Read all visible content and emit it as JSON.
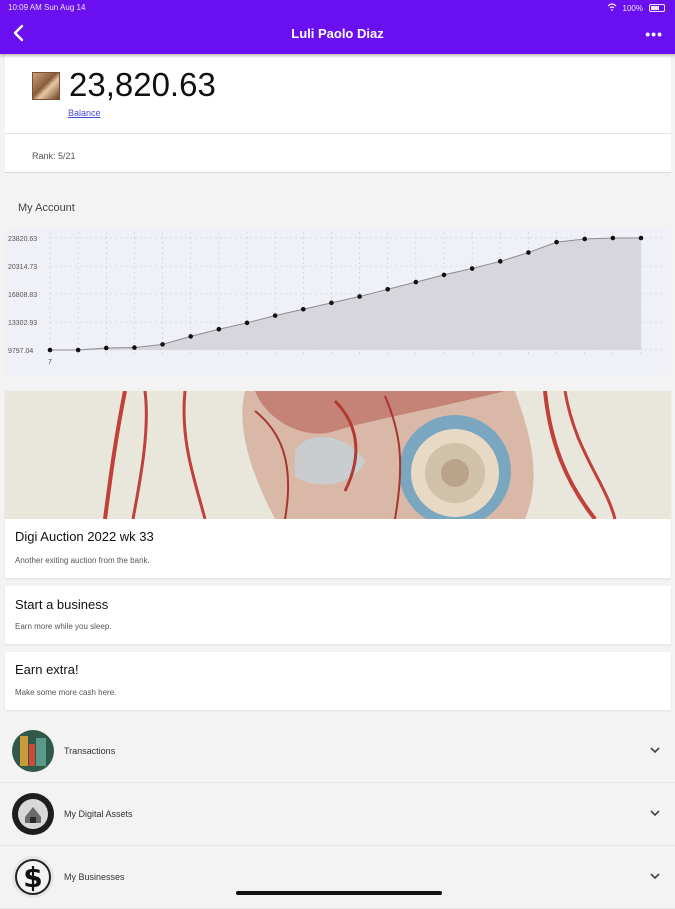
{
  "status_bar": {
    "time_date": "10:09 AM  Sun Aug 14",
    "battery": "100%"
  },
  "header": {
    "title": "Luli Paolo Diaz",
    "more_label": "•••"
  },
  "balance": {
    "amount": "23,820.63",
    "link_label": "Balance"
  },
  "rank": {
    "text": "Rank: 5/21"
  },
  "account": {
    "section_title": "My Account"
  },
  "chart_data": {
    "type": "area",
    "title": "",
    "xlabel": "",
    "ylabel": "",
    "y_tick_labels": [
      "23820.63",
      "20314.73",
      "16808.83",
      "13302.93",
      "9797.04"
    ],
    "x_tick_labels": [
      "7"
    ],
    "ylim": [
      9797.04,
      23820.63
    ],
    "grid": true,
    "series": [
      {
        "values": [
          9797.04,
          9797.04,
          10050,
          10100,
          10500,
          11500,
          12400,
          13200,
          14100,
          14900,
          15700,
          16500,
          17400,
          18300,
          19200,
          20000,
          20900,
          22000,
          23300,
          23700,
          23820.63,
          23820.63
        ]
      }
    ]
  },
  "cards": [
    {
      "title": "Digi Auction 2022 wk 33",
      "subtitle": "Another exiting auction from the bank."
    },
    {
      "title": "Start a business",
      "subtitle": "Earn more while you sleep."
    },
    {
      "title": "Earn extra!",
      "subtitle": "Make some more cash here."
    }
  ],
  "list": [
    {
      "label": "Transactions"
    },
    {
      "label": "My Digital Assets"
    },
    {
      "label": "My Businesses"
    }
  ]
}
